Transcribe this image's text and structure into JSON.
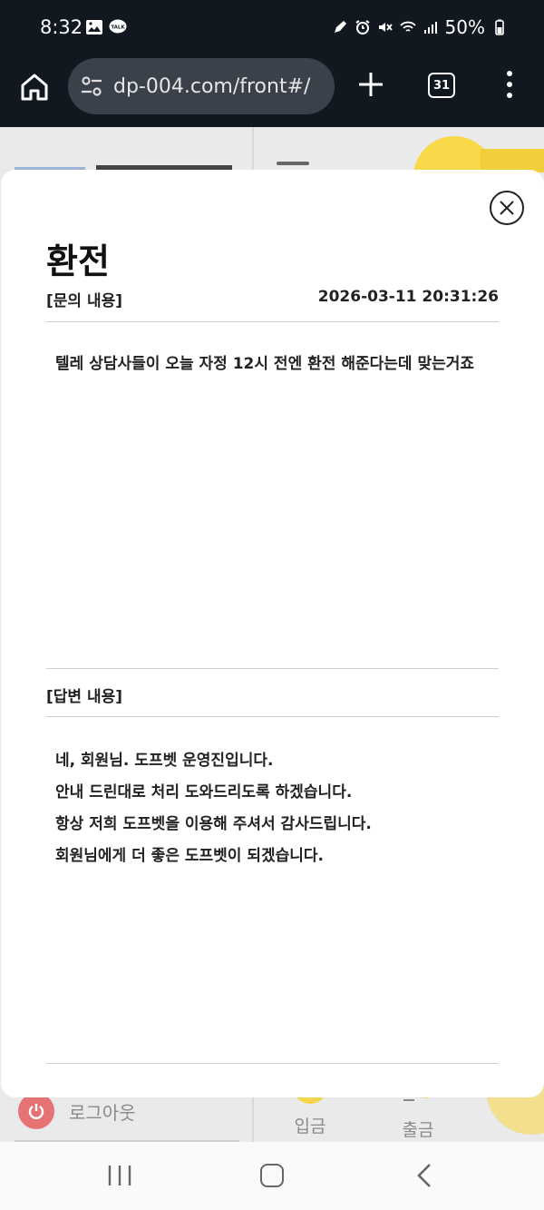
{
  "status_bar": {
    "time": "8:32",
    "battery": "50%",
    "left_icons": [
      "gallery-icon",
      "kakaotalk-icon"
    ],
    "right_icons": [
      "pen-icon",
      "alarm-icon",
      "mute-icon",
      "wifi-icon",
      "signal-icon",
      "battery-icon"
    ]
  },
  "browser": {
    "url": "dp-004.com/front#/",
    "tab_count": "31"
  },
  "background": {
    "logout_label": "로그아웃",
    "deposit_label": "입금",
    "withdraw_label": "출금"
  },
  "modal": {
    "title": "환전",
    "question_label": "[문의 내용]",
    "question_date": "2026-03-11 20:31:26",
    "question_text": "텔레 상담사들이 오늘 자정 12시 전엔 환전 해준다는데 맞는거죠",
    "answer_label": "[답변 내용]",
    "answer_lines": [
      "네, 회원님. 도프벳 운영진입니다.",
      "안내 드린대로 처리 도와드리도록 하겠습니다.",
      "항상 저희 도프벳을 이용해 주셔서 감사드립니다.",
      "회원님에게 더 좋은 도프벳이 되겠습니다."
    ]
  },
  "colors": {
    "status_bar_bg": "#121820",
    "url_bar_bg": "#3b414a",
    "modal_bg": "#ffffff",
    "accent_yellow": "#f3d64d",
    "logout_red": "#e57373"
  }
}
